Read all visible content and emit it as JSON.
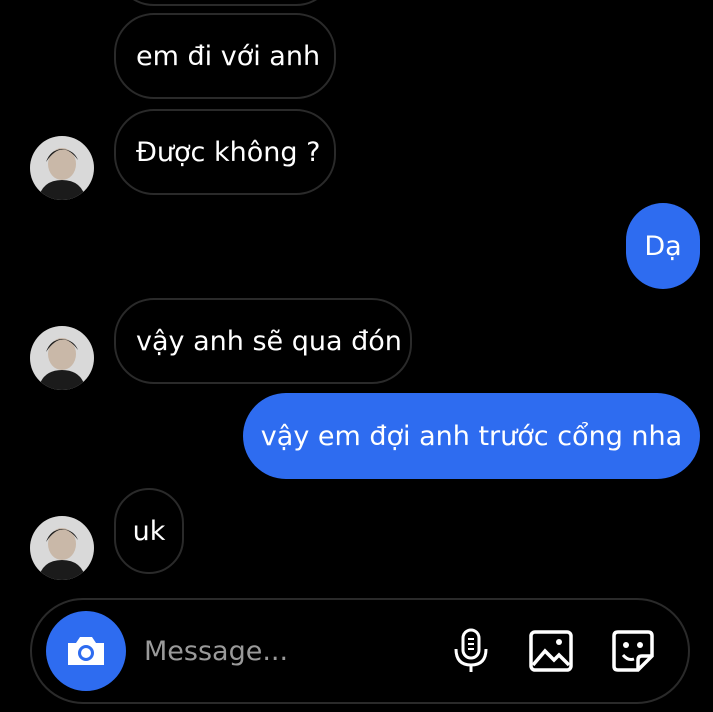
{
  "conversation": {
    "messages": [
      {
        "side": "incoming",
        "text": "em đi với anh"
      },
      {
        "side": "incoming",
        "text": "Được không ?"
      },
      {
        "side": "outgoing",
        "text": "Dạ"
      },
      {
        "side": "incoming",
        "text": "vậy anh sẽ qua đón"
      },
      {
        "side": "outgoing",
        "text": "vậy em đợi anh trước cổng nha"
      },
      {
        "side": "incoming",
        "text": "uk"
      }
    ]
  },
  "composer": {
    "placeholder": "Message...",
    "value": "",
    "camera_icon": "camera-icon",
    "mic_icon": "microphone-icon",
    "gallery_icon": "gallery-icon",
    "sticker_icon": "sticker-icon"
  },
  "colors": {
    "background": "#000000",
    "outgoing_bubble": "#2e6cf0",
    "incoming_border": "#2a2a2a",
    "placeholder": "#9a9a9a"
  }
}
